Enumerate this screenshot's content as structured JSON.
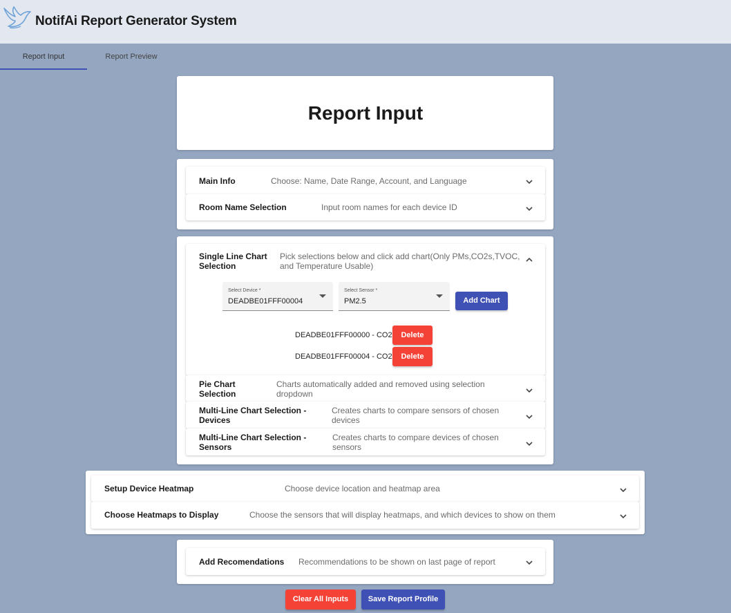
{
  "app": {
    "title": "NotifAi Report Generator System"
  },
  "tabs": [
    "Report Input",
    "Report Preview"
  ],
  "page_title": "Report Input",
  "panels": {
    "main_info": {
      "title": "Main Info",
      "desc": "Choose: Name, Date Range, Account, and Language"
    },
    "room_name": {
      "title": "Room Name Selection",
      "desc": "Input room names for each device ID"
    },
    "single_line": {
      "title_1": "Single Line Chart",
      "title_2": "Selection",
      "desc_1": "Pick selections below and click add chart(Only PMs,CO2s,TVOC,",
      "desc_2": "and Temperature Usable)",
      "device_label": "Select Device *",
      "device_value": "DEADBE01FFF00004",
      "sensor_label": "Select Sensor *",
      "sensor_value": "PM2.5",
      "add_chart": "Add Chart",
      "charts": [
        {
          "label": "DEADBE01FFF00000 - CO2",
          "delete": "Delete"
        },
        {
          "label": "DEADBE01FFF00004 - CO2",
          "delete": "Delete"
        }
      ]
    },
    "pie_chart": {
      "title_1": "Pie Chart",
      "title_2": "Selection",
      "desc_1": "Charts automatically added and removed using selection",
      "desc_2": "dropdown"
    },
    "multi_devices": {
      "title_1": "Multi-Line Chart Selection -",
      "title_2": "Devices",
      "desc_1": "Creates charts to compare sensors of chosen",
      "desc_2": "devices"
    },
    "multi_sensors": {
      "title_1": "Multi-Line Chart Selection -",
      "title_2": "Sensors",
      "desc_1": "Creates charts to compare devices of chosen",
      "desc_2": "sensors"
    },
    "heatmap_setup": {
      "title": "Setup Device Heatmap",
      "desc": "Choose device location and heatmap area"
    },
    "heatmap_display": {
      "title": "Choose Heatmaps to Display",
      "desc": "Choose the sensors that will display heatmaps, and which devices to show on them"
    },
    "recommendations": {
      "title": "Add Recomendations",
      "desc": "Recommendations to be shown on last page of report"
    }
  },
  "footer": {
    "clear": "Clear All Inputs",
    "save": "Save Report Profile"
  },
  "colors": {
    "primary": "#3f51b5",
    "danger": "#f44336",
    "background": "#94a6c0",
    "appbar": "#e3e8f0"
  },
  "icons": {
    "logo": "dove-logo-icon",
    "expand": "chevron-down-icon",
    "collapse": "chevron-up-icon"
  }
}
